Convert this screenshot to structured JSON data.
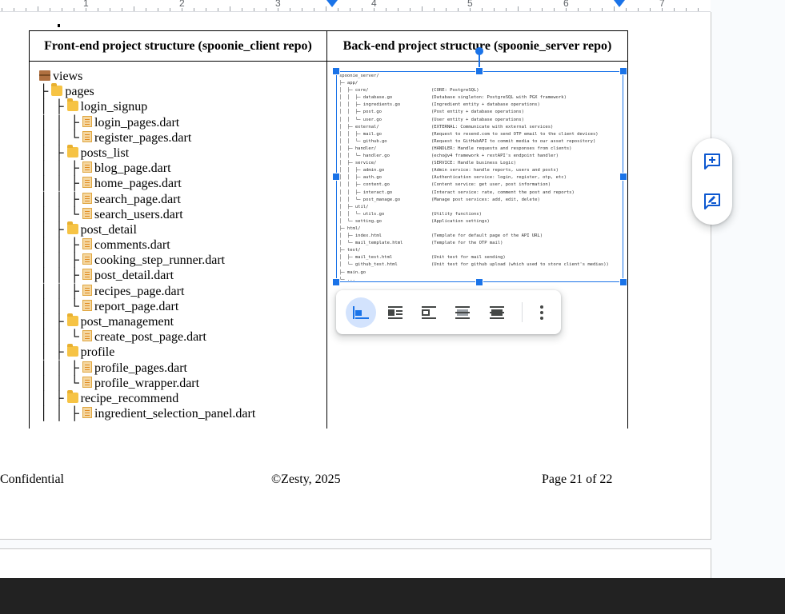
{
  "ruler": {
    "numbers": [
      "1",
      "2",
      "3",
      "4",
      "5",
      "6",
      "7"
    ]
  },
  "table": {
    "headers": [
      "Front-end project structure (spoonie_client repo)",
      "Back-end project structure (spoonie_server repo)"
    ],
    "tree": [
      {
        "prefix": "",
        "icon": "box",
        "name": "views"
      },
      {
        "prefix": "├ ",
        "icon": "folder",
        "name": "pages"
      },
      {
        "prefix": "│  ├ ",
        "icon": "folder",
        "name": "login_signup"
      },
      {
        "prefix": "│  │  ├ ",
        "icon": "file",
        "name": "login_pages.dart"
      },
      {
        "prefix": "│  │  └ ",
        "icon": "file",
        "name": "register_pages.dart"
      },
      {
        "prefix": "│  ├ ",
        "icon": "folder",
        "name": "posts_list"
      },
      {
        "prefix": "│  │  ├ ",
        "icon": "file",
        "name": "blog_page.dart"
      },
      {
        "prefix": "│  │  ├ ",
        "icon": "file",
        "name": "home_pages.dart"
      },
      {
        "prefix": "│  │  ├ ",
        "icon": "file",
        "name": "search_page.dart"
      },
      {
        "prefix": "│  │  └ ",
        "icon": "file",
        "name": "search_users.dart"
      },
      {
        "prefix": "│  ├ ",
        "icon": "folder",
        "name": "post_detail"
      },
      {
        "prefix": "│  │  ├ ",
        "icon": "file",
        "name": "comments.dart"
      },
      {
        "prefix": "│  │  ├ ",
        "icon": "file",
        "name": "cooking_step_runner.dart"
      },
      {
        "prefix": "│  │  ├ ",
        "icon": "file",
        "name": "post_detail.dart"
      },
      {
        "prefix": "│  │  ├ ",
        "icon": "file",
        "name": "recipes_page.dart"
      },
      {
        "prefix": "│  │  └ ",
        "icon": "file",
        "name": "report_page.dart"
      },
      {
        "prefix": "│  ├ ",
        "icon": "folder",
        "name": "post_management"
      },
      {
        "prefix": "│  │  └ ",
        "icon": "file",
        "name": "create_post_page.dart"
      },
      {
        "prefix": "│  ├ ",
        "icon": "folder",
        "name": "profile"
      },
      {
        "prefix": "│  │  ├ ",
        "icon": "file",
        "name": "profile_pages.dart"
      },
      {
        "prefix": "│  │  └ ",
        "icon": "file",
        "name": "profile_wrapper.dart"
      },
      {
        "prefix": "│  ├ ",
        "icon": "folder",
        "name": "recipe_recommend"
      },
      {
        "prefix": "│  │  ├ ",
        "icon": "file",
        "name": "ingredient_selection_panel.dart"
      }
    ],
    "server_tree": [
      [
        "spoonie_server/",
        ""
      ],
      [
        "├─ app/",
        ""
      ],
      [
        "│  ├─ core/",
        "(CORE: PostgreSQL)"
      ],
      [
        "│  │  ├─ database.go",
        "(Database singleton: PostgreSQL with PGX framework)"
      ],
      [
        "│  │  ├─ ingredients.go",
        "(Ingredient entity + database operations)"
      ],
      [
        "│  │  ├─ post.go",
        "(Post entity + database operations)"
      ],
      [
        "│  │  └─ user.go",
        "(User entity + database operations)"
      ],
      [
        "│  ├─ external/",
        "(EXTERNAL: Communicate with external services)"
      ],
      [
        "│  │  ├─ mail.go",
        "(Request to resend.com to send OTP email to the client devices)"
      ],
      [
        "│  │  └─ github.go",
        "(Request to GitHubAPI to commit media to our asset repository)"
      ],
      [
        "│  ├─ handler/",
        "(HANDLER: Handle requests and responses from clients)"
      ],
      [
        "│  │  └─ handler.go",
        "(echo@v4 framework + restAPI's endpoint handler)"
      ],
      [
        "│  ├─ service/",
        "(SERVICE: Handle business Logic)"
      ],
      [
        "│  │  ├─ admin.go",
        "(Admin service: handle reports, users and posts)"
      ],
      [
        "│  │  ├─ auth.go",
        "(Authentication service: login, register, otp, etc)"
      ],
      [
        "│  │  ├─ content.go",
        "(Content service: get user, post information)"
      ],
      [
        "│  │  ├─ interact.go",
        "(Interact service: rate, comment the post and reports)"
      ],
      [
        "│  │  └─ post_manage.go",
        "(Manage post services: add, edit, delete)"
      ],
      [
        "│  ├─ util/",
        ""
      ],
      [
        "│  │  └─ utils.go",
        "(Utility functions)"
      ],
      [
        "│  └─ setting.go",
        "(Application settings)"
      ],
      [
        "├─ html/",
        ""
      ],
      [
        "│  ├─ index.html",
        "(Template for default page of the API URL)"
      ],
      [
        "│  └─ mail_template.html",
        "(Template for the OTP mail)"
      ],
      [
        "├─ test/",
        ""
      ],
      [
        "│  ├─ mail_test.html",
        "(Unit test for mail sending)"
      ],
      [
        "│  └─ github_test.html",
        "(Unit test for github upload (which used to store client's medias))"
      ],
      [
        "├─ main.go",
        ""
      ],
      [
        "└─ ...",
        ""
      ]
    ]
  },
  "footer": {
    "left": "Confidential",
    "center": "©Zesty, 2025",
    "right": "Page 21 of 22"
  },
  "colors": {
    "accent": "#1a73e8",
    "toolbar_active": "#d3e3fd"
  }
}
